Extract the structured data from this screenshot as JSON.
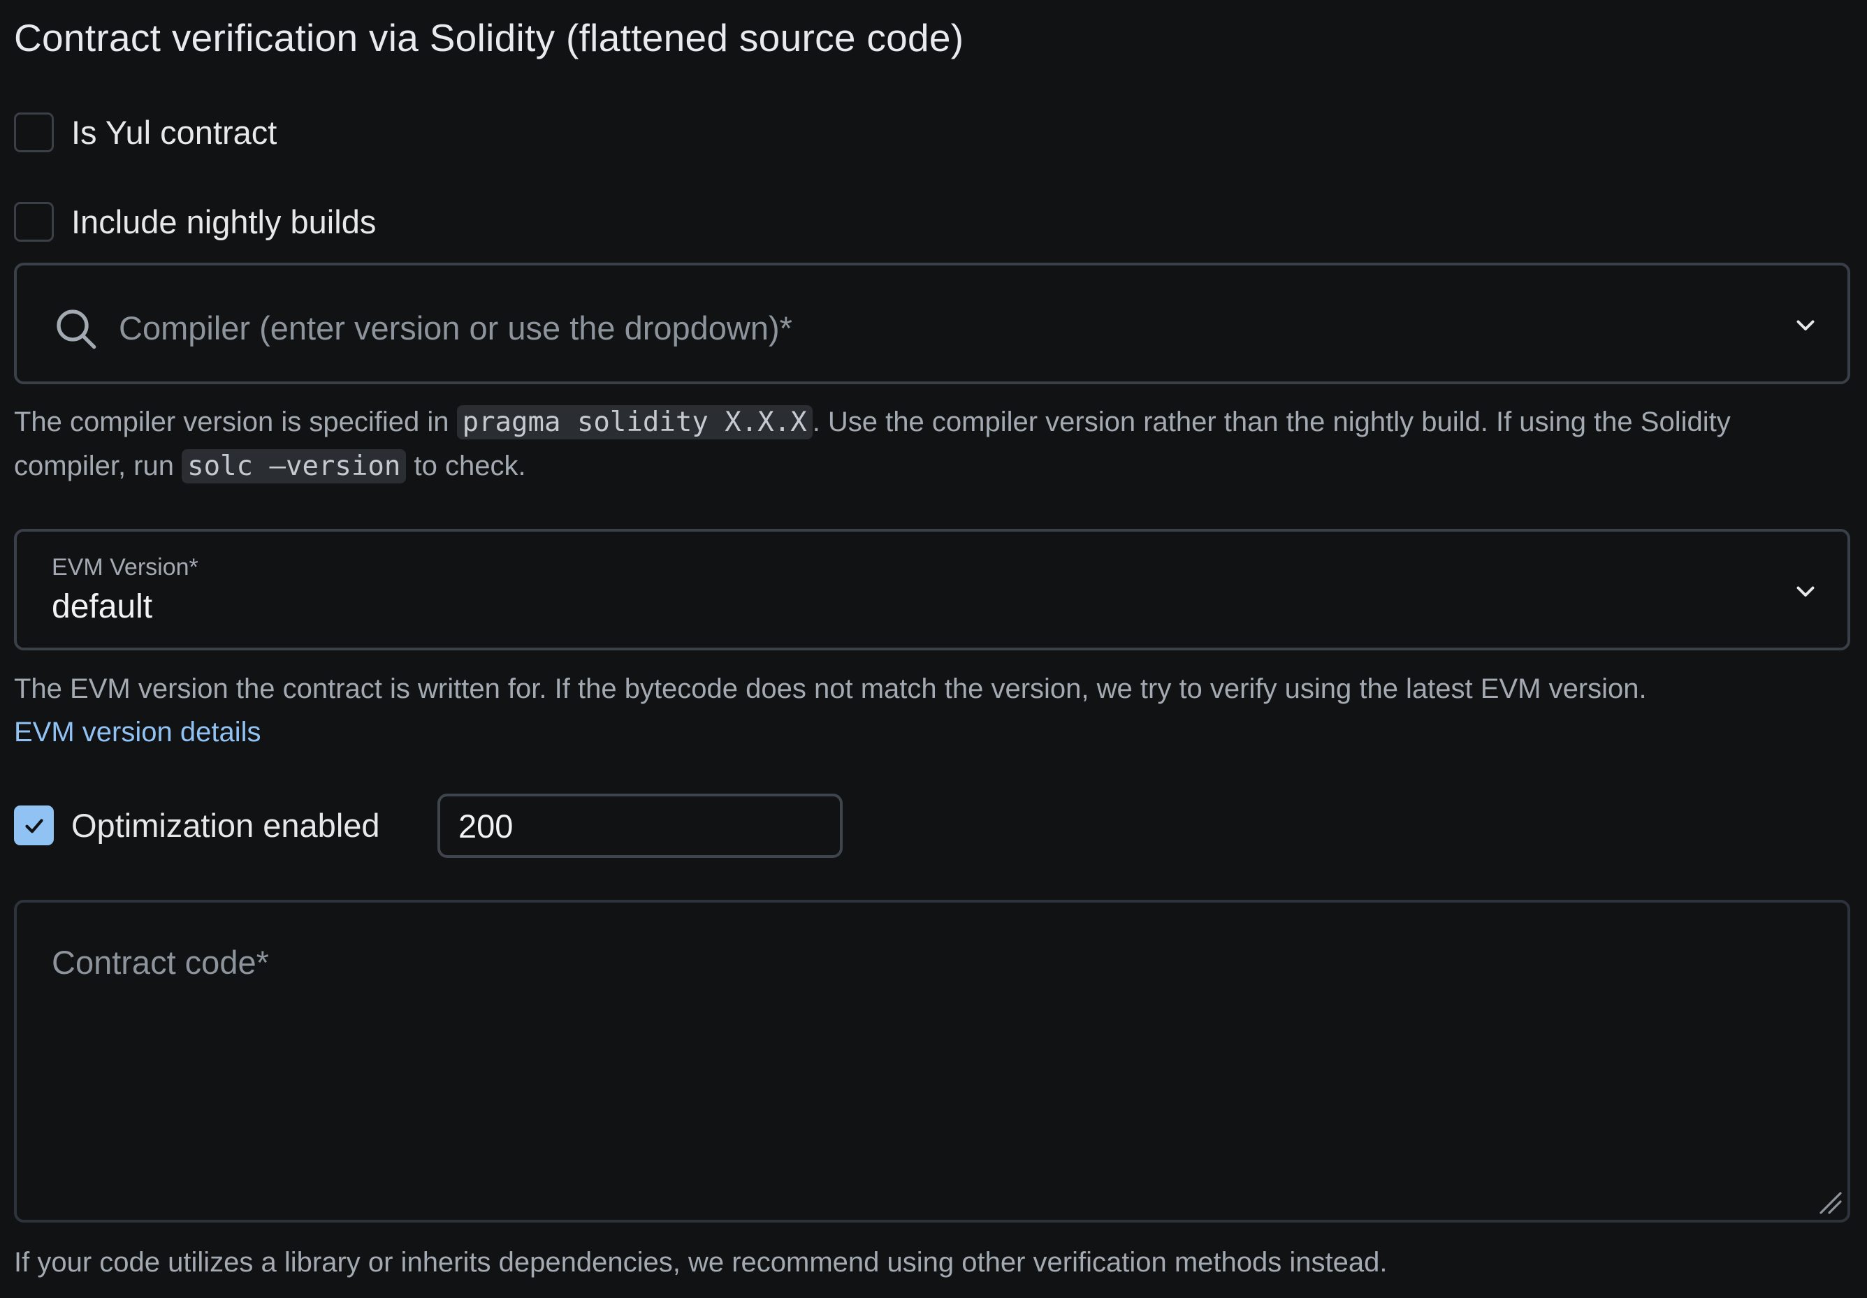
{
  "title": "Contract verification via Solidity (flattened source code)",
  "yul_checkbox": {
    "label": "Is Yul contract",
    "checked": false
  },
  "nightly_checkbox": {
    "label": "Include nightly builds",
    "checked": false
  },
  "compiler": {
    "placeholder": "Compiler (enter version or use the dropdown)*",
    "hint": {
      "part1": "The compiler version is specified in ",
      "code1": "pragma solidity X.X.X",
      "part2": ". Use the compiler version rather than the nightly build. If using the Solidity compiler, run ",
      "code2": "solc —version",
      "part3": " to check."
    }
  },
  "evm": {
    "label": "EVM Version*",
    "value": "default",
    "hint": "The EVM version the contract is written for. If the bytecode does not match the version, we try to verify using the latest EVM version.",
    "link": "EVM version details"
  },
  "optimization": {
    "label": "Optimization enabled",
    "checked": true,
    "runs": "200"
  },
  "contract_code": {
    "placeholder": "Contract code*",
    "hint": "If your code utilizes a library or inherits dependencies, we recommend using other verification methods instead."
  },
  "colors": {
    "background": "#101214",
    "accent": "#90c2f4",
    "border": "#3a4048"
  }
}
